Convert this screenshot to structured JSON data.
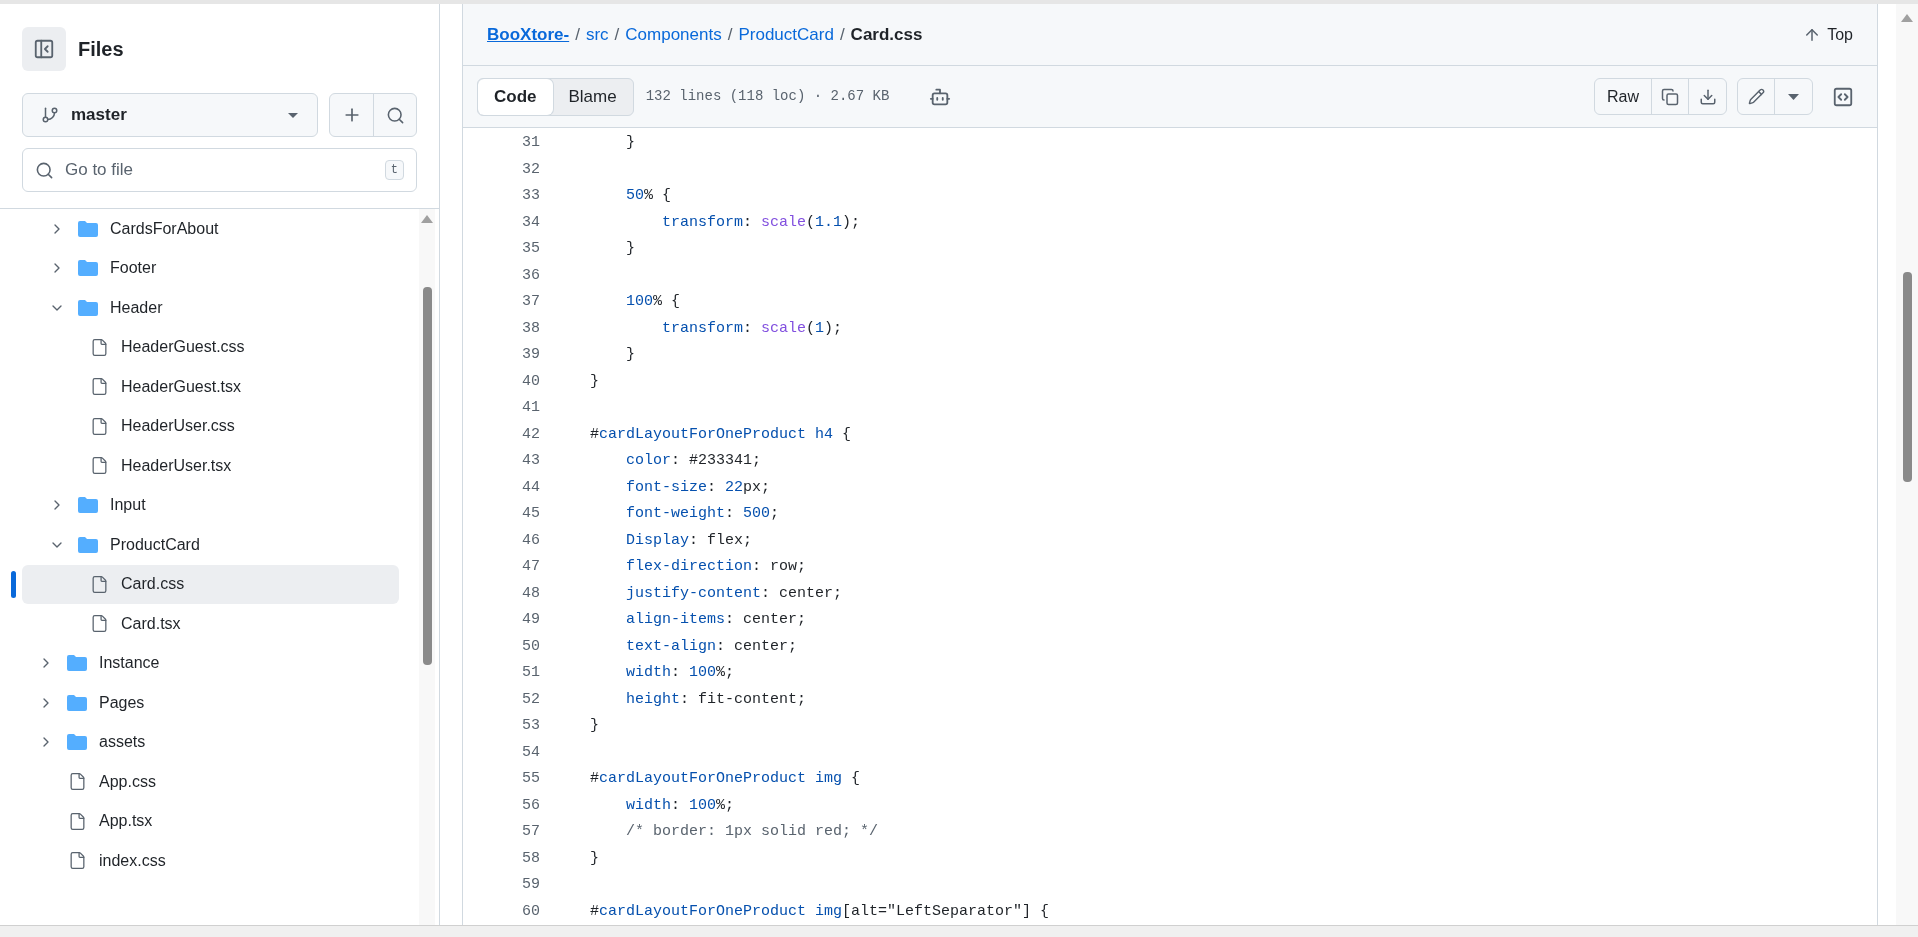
{
  "sidebar": {
    "title": "Files",
    "branch": "master",
    "search": {
      "placeholder": "Go to file",
      "shortcut": "t"
    },
    "tree": [
      {
        "kind": "hidden-parent",
        "children": [
          {
            "name": "CardsForAbout",
            "kind": "folder",
            "expanded": false,
            "selected": false
          },
          {
            "name": "Footer",
            "kind": "folder",
            "expanded": false,
            "selected": false
          },
          {
            "name": "Header",
            "kind": "folder",
            "expanded": true,
            "selected": false,
            "children": [
              {
                "name": "HeaderGuest.css",
                "kind": "file",
                "selected": false
              },
              {
                "name": "HeaderGuest.tsx",
                "kind": "file",
                "selected": false
              },
              {
                "name": "HeaderUser.css",
                "kind": "file",
                "selected": false
              },
              {
                "name": "HeaderUser.tsx",
                "kind": "file",
                "selected": false
              }
            ]
          },
          {
            "name": "Input",
            "kind": "folder",
            "expanded": false,
            "selected": false
          },
          {
            "name": "ProductCard",
            "kind": "folder",
            "expanded": true,
            "selected": false,
            "children": [
              {
                "name": "Card.css",
                "kind": "file",
                "selected": true
              },
              {
                "name": "Card.tsx",
                "kind": "file",
                "selected": false
              }
            ]
          }
        ]
      },
      {
        "name": "Instance",
        "kind": "folder",
        "expanded": false,
        "selected": false
      },
      {
        "name": "Pages",
        "kind": "folder",
        "expanded": false,
        "selected": false
      },
      {
        "name": "assets",
        "kind": "folder",
        "expanded": false,
        "selected": false
      },
      {
        "name": "App.css",
        "kind": "file",
        "selected": false
      },
      {
        "name": "App.tsx",
        "kind": "file",
        "selected": false
      },
      {
        "name": "index.css",
        "kind": "file",
        "selected": false
      }
    ]
  },
  "breadcrumbs": [
    {
      "text": "BooXtore-",
      "kind": "repo"
    },
    {
      "text": "/",
      "kind": "separator"
    },
    {
      "text": "src",
      "kind": "dir"
    },
    {
      "text": "/",
      "kind": "separator"
    },
    {
      "text": "Components",
      "kind": "dir"
    },
    {
      "text": "/",
      "kind": "separator"
    },
    {
      "text": "ProductCard",
      "kind": "dir"
    },
    {
      "text": "/",
      "kind": "separator"
    },
    {
      "text": "Card.css",
      "kind": "file"
    }
  ],
  "top_link": "Top",
  "toolbar": {
    "tabs": [
      {
        "label": "Code",
        "selected": true
      },
      {
        "label": "Blame",
        "selected": false
      }
    ],
    "file_info": "132 lines (118 loc) · 2.67 KB",
    "raw_button": "Raw"
  },
  "code": {
    "lines": [
      {
        "number": "31",
        "tokens": [
          {
            "text": "    }",
            "kind": "plain"
          }
        ]
      },
      {
        "number": "32"
      },
      {
        "number": "33",
        "tokens": [
          {
            "text": "    50",
            "kind": "number"
          },
          {
            "text": "% {",
            "kind": "plain"
          }
        ]
      },
      {
        "number": "34",
        "tokens": [
          {
            "text": "        transform",
            "kind": "property"
          },
          {
            "text": ": ",
            "kind": "plain"
          },
          {
            "text": "scale",
            "kind": "function"
          },
          {
            "text": "(",
            "kind": "plain"
          },
          {
            "text": "1.1",
            "kind": "number"
          },
          {
            "text": ");",
            "kind": "plain"
          }
        ]
      },
      {
        "number": "35",
        "tokens": [
          {
            "text": "    }",
            "kind": "plain"
          }
        ]
      },
      {
        "number": "36"
      },
      {
        "number": "37",
        "tokens": [
          {
            "text": "    100",
            "kind": "number"
          },
          {
            "text": "% {",
            "kind": "plain"
          }
        ]
      },
      {
        "number": "38",
        "tokens": [
          {
            "text": "        transform",
            "kind": "property"
          },
          {
            "text": ": ",
            "kind": "plain"
          },
          {
            "text": "scale",
            "kind": "function"
          },
          {
            "text": "(",
            "kind": "plain"
          },
          {
            "text": "1",
            "kind": "number"
          },
          {
            "text": ");",
            "kind": "plain"
          }
        ]
      },
      {
        "number": "39",
        "tokens": [
          {
            "text": "    }",
            "kind": "plain"
          }
        ]
      },
      {
        "number": "40",
        "tokens": [
          {
            "text": "}",
            "kind": "plain"
          }
        ]
      },
      {
        "number": "41"
      },
      {
        "number": "42",
        "tokens": [
          {
            "text": "#",
            "kind": "plain"
          },
          {
            "text": "cardLayoutForOneProduct h4",
            "kind": "property"
          },
          {
            "text": " {",
            "kind": "plain"
          }
        ]
      },
      {
        "number": "43",
        "tokens": [
          {
            "text": "    color",
            "kind": "property"
          },
          {
            "text": ": #233341;",
            "kind": "plain"
          }
        ]
      },
      {
        "number": "44",
        "tokens": [
          {
            "text": "    font-size",
            "kind": "property"
          },
          {
            "text": ": ",
            "kind": "plain"
          },
          {
            "text": "22",
            "kind": "number"
          },
          {
            "text": "px;",
            "kind": "plain"
          }
        ]
      },
      {
        "number": "45",
        "tokens": [
          {
            "text": "    font-weight",
            "kind": "property"
          },
          {
            "text": ": ",
            "kind": "plain"
          },
          {
            "text": "500",
            "kind": "number"
          },
          {
            "text": ";",
            "kind": "plain"
          }
        ]
      },
      {
        "number": "46",
        "tokens": [
          {
            "text": "    Display",
            "kind": "property"
          },
          {
            "text": ": flex;",
            "kind": "plain"
          }
        ]
      },
      {
        "number": "47",
        "tokens": [
          {
            "text": "    flex-direction",
            "kind": "property"
          },
          {
            "text": ": row;",
            "kind": "plain"
          }
        ]
      },
      {
        "number": "48",
        "tokens": [
          {
            "text": "    justify-content",
            "kind": "property"
          },
          {
            "text": ": center;",
            "kind": "plain"
          }
        ]
      },
      {
        "number": "49",
        "tokens": [
          {
            "text": "    align-items",
            "kind": "property"
          },
          {
            "text": ": center;",
            "kind": "plain"
          }
        ]
      },
      {
        "number": "50",
        "tokens": [
          {
            "text": "    text-align",
            "kind": "property"
          },
          {
            "text": ": center;",
            "kind": "plain"
          }
        ]
      },
      {
        "number": "51",
        "tokens": [
          {
            "text": "    width",
            "kind": "property"
          },
          {
            "text": ": ",
            "kind": "plain"
          },
          {
            "text": "100",
            "kind": "number"
          },
          {
            "text": "%;",
            "kind": "plain"
          }
        ]
      },
      {
        "number": "52",
        "tokens": [
          {
            "text": "    height",
            "kind": "property"
          },
          {
            "text": ": fit-content;",
            "kind": "plain"
          }
        ]
      },
      {
        "number": "53",
        "tokens": [
          {
            "text": "}",
            "kind": "plain"
          }
        ]
      },
      {
        "number": "54"
      },
      {
        "number": "55",
        "tokens": [
          {
            "text": "#",
            "kind": "plain"
          },
          {
            "text": "cardLayoutForOneProduct img",
            "kind": "property"
          },
          {
            "text": " {",
            "kind": "plain"
          }
        ]
      },
      {
        "number": "56",
        "tokens": [
          {
            "text": "    width",
            "kind": "property"
          },
          {
            "text": ": ",
            "kind": "plain"
          },
          {
            "text": "100",
            "kind": "number"
          },
          {
            "text": "%;",
            "kind": "plain"
          }
        ]
      },
      {
        "number": "57",
        "tokens": [
          {
            "text": "    /* border: 1px solid red; */",
            "kind": "comment"
          }
        ]
      },
      {
        "number": "58",
        "tokens": [
          {
            "text": "}",
            "kind": "plain"
          }
        ]
      },
      {
        "number": "59"
      },
      {
        "number": "60",
        "tokens": [
          {
            "text": "#",
            "kind": "plain"
          },
          {
            "text": "cardLayoutForOneProduct img",
            "kind": "property"
          },
          {
            "text": "[alt=\"LeftSeparator\"] {",
            "kind": "plain"
          }
        ]
      }
    ]
  }
}
